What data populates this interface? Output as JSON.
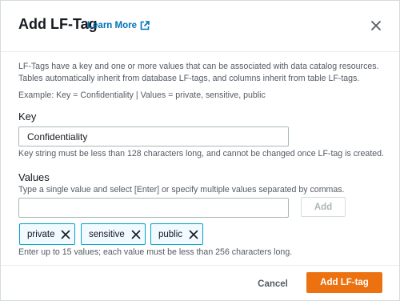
{
  "modal": {
    "title": "Add LF-Tag",
    "learn_more": "Learn More",
    "description": "LF-Tags have a key and one or more values that can be associated with data catalog resources. Tables automatically inherit from database LF-tags, and columns inherit from table LF-tags.",
    "example": "Example: Key = Confidentiality | Values = private, sensitive, public"
  },
  "key_field": {
    "label": "Key",
    "value": "Confidentiality",
    "hint": "Key string must be less than 128 characters long, and cannot be changed once LF-tag is created."
  },
  "values_field": {
    "label": "Values",
    "description": "Type a single value and select [Enter] or specify multiple values separated by commas.",
    "value": "",
    "add_label": "Add",
    "tags": [
      "private",
      "sensitive",
      "public"
    ],
    "hint": "Enter up to 15 values; each value must be less than 256 characters long."
  },
  "footer": {
    "cancel_label": "Cancel",
    "submit_label": "Add LF-tag"
  },
  "colors": {
    "primary": "#ec7211",
    "link": "#0073bb",
    "tag_border": "#00a1c9"
  }
}
